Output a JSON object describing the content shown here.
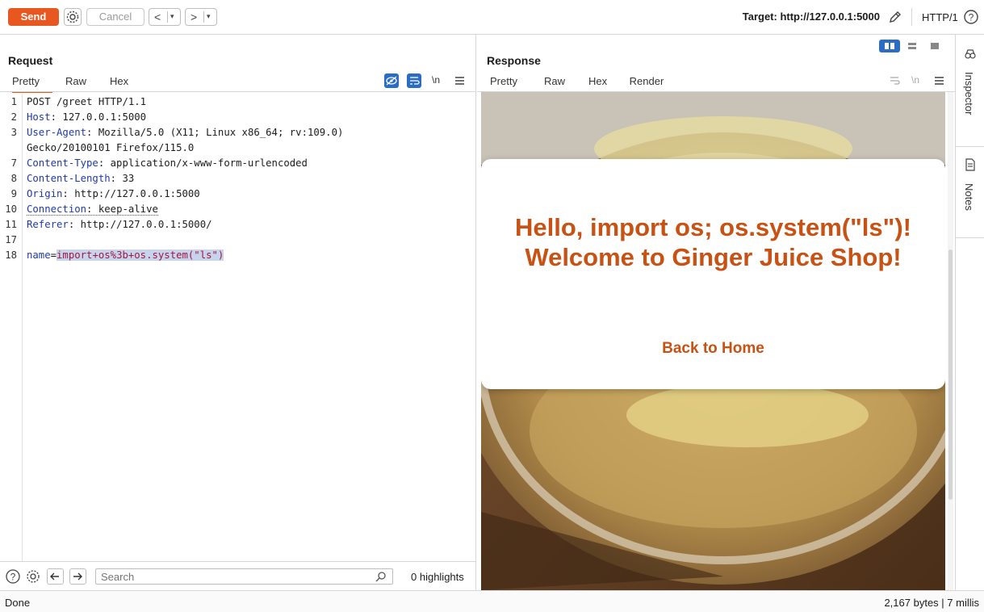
{
  "toolbar": {
    "send_label": "Send",
    "cancel_label": "Cancel",
    "prev_glyph": "<",
    "next_glyph": ">",
    "dropdown_glyph": "▾",
    "target_label": "Target: http://127.0.0.1:5000",
    "protocol_label": "HTTP/1",
    "accent_color": "#e8571f"
  },
  "request": {
    "title": "Request",
    "tabs": [
      {
        "label": "Pretty",
        "active": true
      },
      {
        "label": "Raw"
      },
      {
        "label": "Hex"
      }
    ],
    "newline_toggle": "\\n",
    "lines": [
      {
        "num": "1",
        "text": "POST /greet HTTP/1.1"
      },
      {
        "num": "2",
        "key": "Host",
        "value": " 127.0.0.1:5000"
      },
      {
        "num": "3",
        "key": "User-Agent",
        "value": " Mozilla/5.0 (X11; Linux x86_64; rv:109.0)"
      },
      {
        "num": "",
        "text": "Gecko/20100101 Firefox/115.0"
      },
      {
        "num": "7",
        "key": "Content-Type",
        "value": " application/x-www-form-urlencoded"
      },
      {
        "num": "8",
        "key": "Content-Length",
        "value": " 33"
      },
      {
        "num": "9",
        "key": "Origin",
        "value": " http://127.0.0.1:5000"
      },
      {
        "num": "10",
        "key": "Connection",
        "value": " keep-alive"
      },
      {
        "num": "11",
        "key": "Referer",
        "value": " http://127.0.0.1:5000/"
      },
      {
        "num": "17",
        "text": ""
      },
      {
        "num": "18",
        "param_name": "name",
        "param_value": "import+os%3b+os.system(\"ls\")"
      }
    ],
    "search_placeholder": "Search",
    "highlights_label": "0 highlights"
  },
  "response": {
    "title": "Response",
    "tabs": [
      {
        "label": "Pretty"
      },
      {
        "label": "Raw"
      },
      {
        "label": "Hex"
      },
      {
        "label": "Render",
        "active": true
      }
    ],
    "newline_toggle": "\\n",
    "render": {
      "heading": "Hello, import os; os.system(\"ls\")! Welcome to Ginger Juice Shop!",
      "link": "Back to Home",
      "heading_color": "#c85114"
    }
  },
  "sidebar": {
    "items": [
      {
        "label": "Inspector",
        "icon": "inspector-icon"
      },
      {
        "label": "Notes",
        "icon": "notes-icon"
      }
    ]
  },
  "status": {
    "left": "Done",
    "right": "2,167 bytes | 7 millis"
  }
}
